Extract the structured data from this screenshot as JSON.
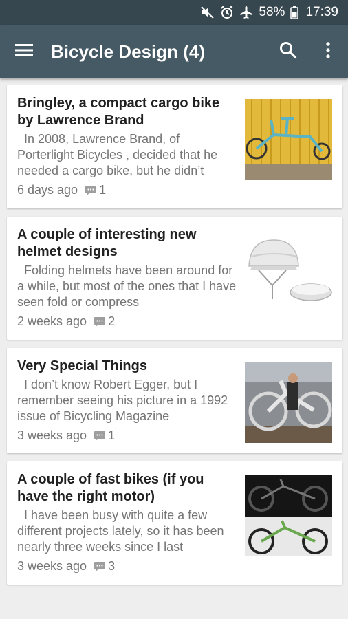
{
  "status_bar": {
    "icons": [
      "mute-icon",
      "alarm-icon",
      "airplane-icon",
      "battery-icon"
    ],
    "battery": "58%",
    "time": "17:39"
  },
  "app_bar": {
    "title": "Bicycle Design (4)",
    "icons": [
      "menu-icon",
      "search-icon",
      "more-vert-icon"
    ]
  },
  "colors": {
    "status_bar": "#37474f",
    "app_bar": "#455a64",
    "background": "#eeeeee"
  },
  "posts": [
    {
      "title": "Bringley, a compact cargo bike by Lawrence Brand",
      "snippet": "  In 2008, Lawrence Brand, of Porterlight Bicycles , decided that he needed a cargo bike, but he didn’t",
      "age": "6 days ago",
      "comments": "1"
    },
    {
      "title": "A couple of interesting new helmet designs",
      "snippet": "  Folding helmets have been around for a while, but most of the ones that I have seen fold or compress",
      "age": "2 weeks ago",
      "comments": "2"
    },
    {
      "title": "Very Special Things",
      "snippet": "  I don’t know Robert Egger, but I remember seeing his picture in a 1992 issue of Bicycling Magazine",
      "age": "3 weeks ago",
      "comments": "1"
    },
    {
      "title": "A couple of fast bikes (if you have the right motor)",
      "snippet": "  I have been busy with quite a few different projects lately, so it has been nearly three weeks since I last",
      "age": "3 weeks ago",
      "comments": "3"
    }
  ]
}
